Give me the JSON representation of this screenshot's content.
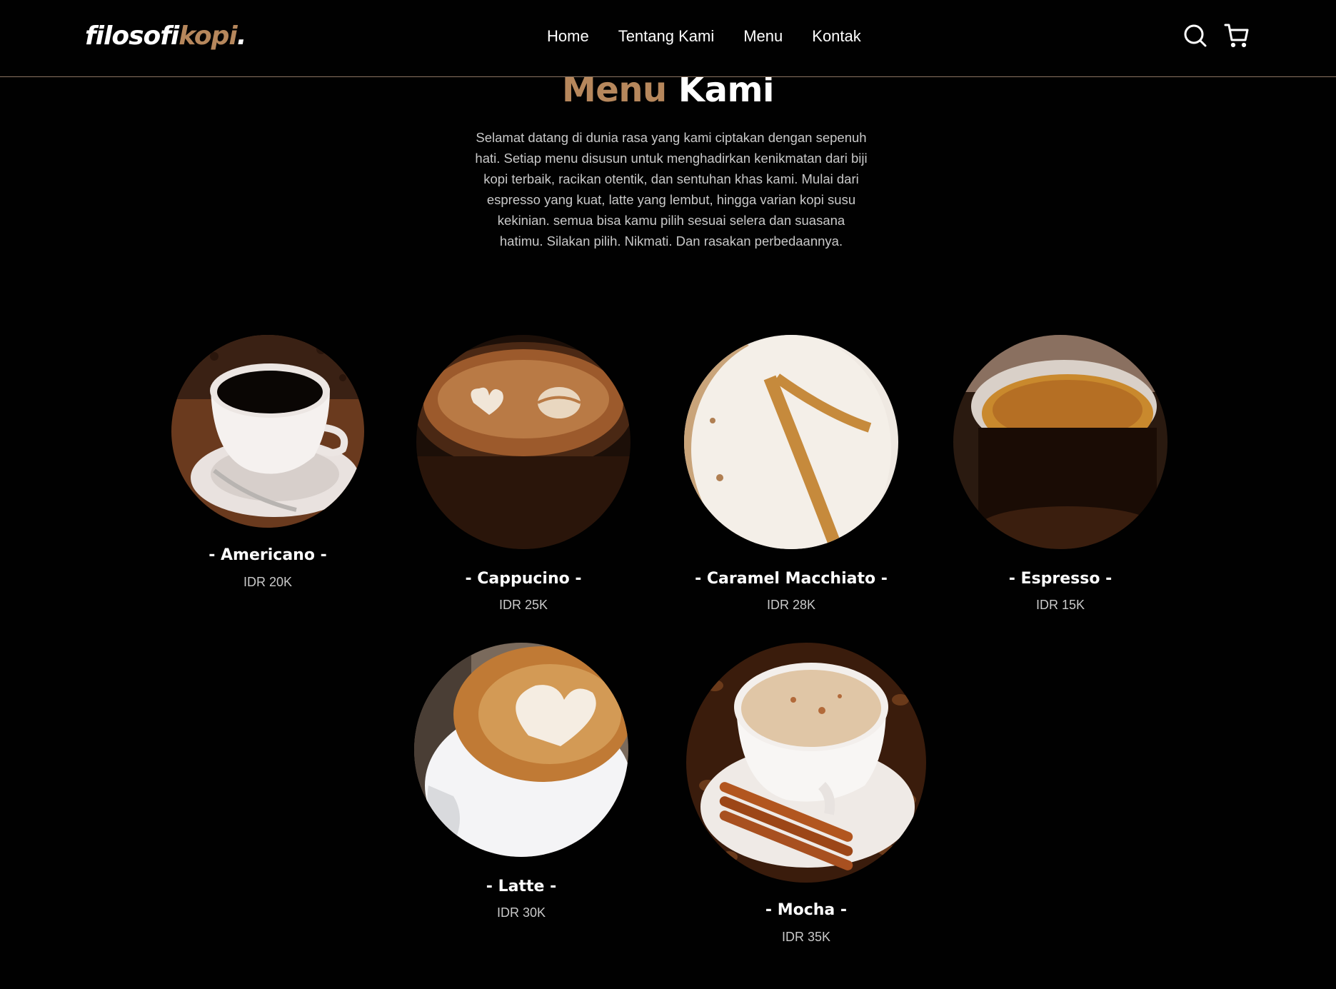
{
  "brand": {
    "logo_main": "filosofi",
    "logo_accent": "kopi",
    "logo_dot": "."
  },
  "nav": {
    "links": [
      {
        "label": "Home"
      },
      {
        "label": "Tentang Kami"
      },
      {
        "label": "Menu"
      },
      {
        "label": "Kontak"
      }
    ],
    "icons": [
      "search-icon",
      "cart-icon"
    ]
  },
  "hero": {
    "title_accent": "Menu",
    "title_main": "Kami",
    "intro": "Selamat datang di dunia rasa yang kami ciptakan dengan sepenuh hati. Setiap menu disusun untuk menghadirkan kenikmatan dari biji kopi terbaik, racikan otentik, dan sentuhan khas kami. Mulai dari espresso yang kuat, latte yang lembut, hingga varian kopi susu kekinian. semua bisa kamu pilih sesuai selera dan suasana hatimu. Silakan pilih. Nikmati. Dan rasakan perbedaannya."
  },
  "menu_items": [
    {
      "name": "- Americano -",
      "price": "IDR 20K"
    },
    {
      "name": "- Cappucino -",
      "price": "IDR 25K"
    },
    {
      "name": "- Caramel Macchiato -",
      "price": "IDR 28K"
    },
    {
      "name": "- Espresso -",
      "price": "IDR 15K"
    },
    {
      "name": "- Latte -",
      "price": "IDR 30K"
    },
    {
      "name": "- Mocha -",
      "price": "IDR 35K"
    }
  ],
  "colors": {
    "background": "#010101",
    "accent": "#b6875c",
    "text": "#ffffff",
    "muted": "#c9c9c9",
    "divider": "#8a7461"
  }
}
